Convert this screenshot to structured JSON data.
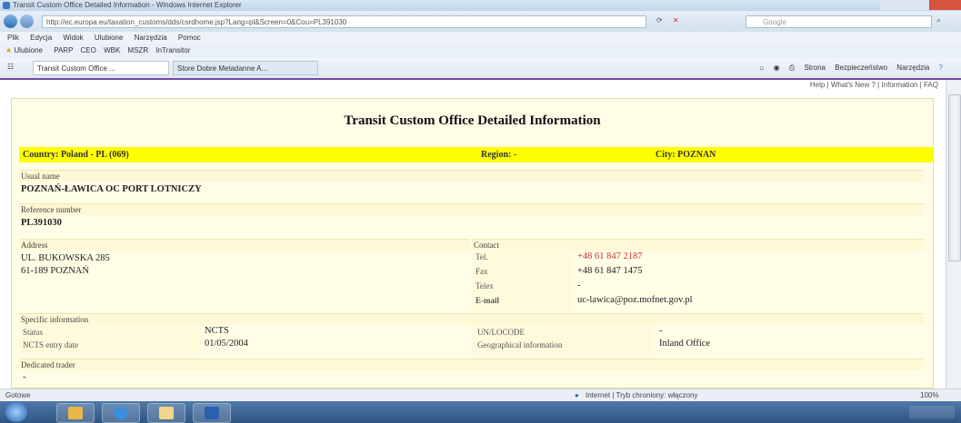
{
  "window": {
    "title": "Transit Custom Office Detailed Information - Windows Internet Explorer"
  },
  "browser": {
    "address": "http://ec.europa.eu/taxation_customs/dds/csrdhome.jsp?Lang=pl&Screen=0&Cou=PL391030",
    "search_placeholder": "Google",
    "menu": [
      "Plik",
      "Edycja",
      "Widok",
      "Ulubione",
      "Narzędzia",
      "Pomoc"
    ],
    "favorites_label": "Ulubione",
    "favorites_items": [
      "PARP",
      "CEO",
      "WBK",
      "MSZR",
      "InTransitor"
    ],
    "tabs": [
      "Transit Custom Office ...",
      "Store Dobre Metadanne A..."
    ],
    "command_items": [
      "Strona",
      "Bezpieczeństwo",
      "Narzędzia"
    ],
    "status_left": "Gotowe",
    "status_zone": "Internet | Tryb chroniony: włączony",
    "zoom": "100%",
    "colors": {
      "accent": "#6f4aa3",
      "highlight": "#ffff00",
      "panel": "#fffde6"
    }
  },
  "page": {
    "help_links": "Help | What's New ? | Information | FAQ",
    "title": "Transit Custom Office Detailed Information",
    "country": "Country: Poland - PL (069)",
    "region": "Region: -",
    "city": "City: POZNAN",
    "usual_name_label": "Usual name",
    "usual_name": "POZNAŃ-ŁAWICA OC PORT LOTNICZY",
    "reference_label": "Reference number",
    "reference": "PL391030",
    "address_label": "Address",
    "address_line1": "UL. BUKOWSKA 285",
    "address_line2": "61-189 POZNAŃ",
    "contact_label": "Contact",
    "tel_label": "Tel.",
    "tel": "+48 61 847 2187",
    "fax_label": "Fax",
    "fax": "+48 61 847 1475",
    "telex_label": "Telex",
    "telex": "-",
    "email_label": "E-mail",
    "email": "uc-lawica@poz.mofnet.gov.pl",
    "specific_label": "Specific information",
    "status_label": "Status",
    "status": "NCTS",
    "ncts_label": "NCTS entry date",
    "ncts_date": "01/05/2004",
    "unlocode_label": "UN/LOCODE",
    "unlocode": "-",
    "geo_label": "Geographical information",
    "geo": "Inland Office",
    "dedicated_label": "Dedicated trader",
    "dedicated": "-"
  }
}
